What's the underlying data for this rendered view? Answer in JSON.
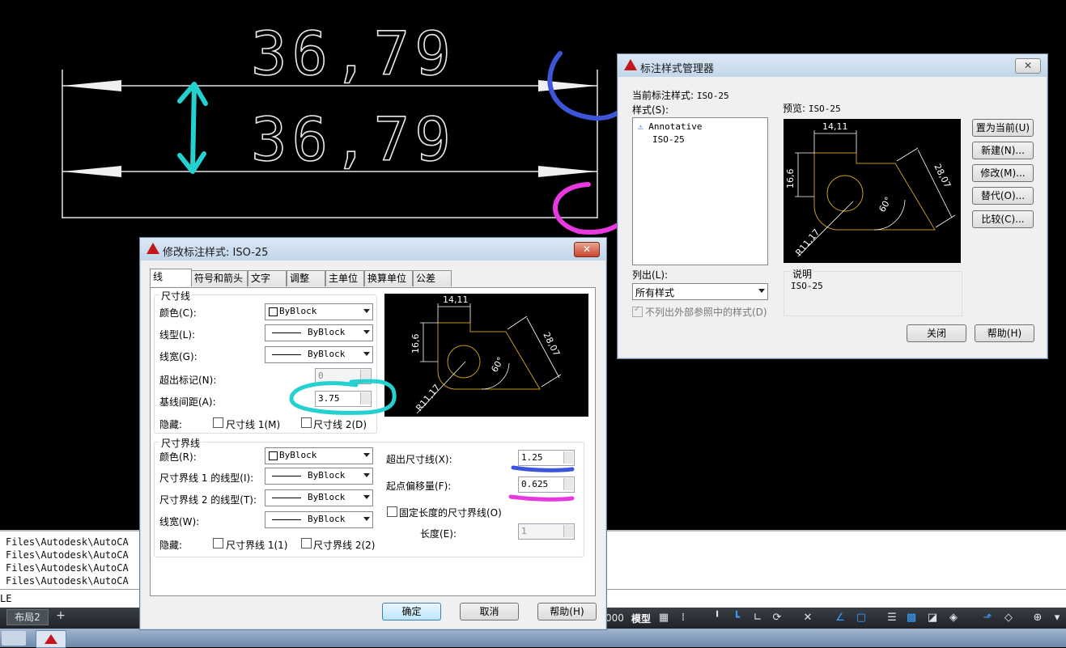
{
  "drawing": {
    "dim_text_top": "36,79",
    "dim_text_bottom": "36,79"
  },
  "command_line": {
    "lines": [
      "Files\\Autodesk\\AutoCA",
      "Files\\Autodesk\\AutoCA",
      "Files\\Autodesk\\AutoCA",
      "Files\\Autodesk\\AutoCA"
    ],
    "input_text": "LE"
  },
  "status_bar": {
    "layout_tab": "布局2",
    "add_tab": "+",
    "coord_tail": "000",
    "model_label": "模型"
  },
  "manager": {
    "title": "标注样式管理器",
    "close": "✕",
    "current_style_label": "当前标注样式:",
    "current_style_value": "ISO-25",
    "styles_label": "样式(S):",
    "styles": [
      "Annotative",
      "ISO-25"
    ],
    "preview_label": "预览:",
    "preview_value": "ISO-25",
    "buttons": {
      "set_current": "置为当前(U)",
      "new": "新建(N)...",
      "modify": "修改(M)...",
      "override": "替代(O)...",
      "compare": "比较(C)..."
    },
    "list_label": "列出(L):",
    "list_value": "所有样式",
    "exclude_xref": "不列出外部参照中的样式(D)",
    "description_label": "说明",
    "description_value": "ISO-25",
    "close_button": "关闭",
    "help_button": "帮助(H)"
  },
  "modify": {
    "title": "修改标注样式: ISO-25",
    "close": "✕",
    "tabs": [
      "线",
      "符号和箭头",
      "文字",
      "调整",
      "主单位",
      "换算单位",
      "公差"
    ],
    "dim_lines": {
      "group_label": "尺寸线",
      "color_label": "颜色(C):",
      "color_value": "ByBlock",
      "linetype_label": "线型(L):",
      "linetype_value": "ByBlock",
      "lineweight_label": "线宽(G):",
      "lineweight_value": "ByBlock",
      "extend_ticks_label": "超出标记(N):",
      "extend_ticks_value": "0",
      "baseline_label": "基线间距(A):",
      "baseline_value": "3.75",
      "suppress_label": "隐藏:",
      "suppress_1": "尺寸线 1(M)",
      "suppress_2": "尺寸线 2(D)"
    },
    "ext_lines": {
      "group_label": "尺寸界线",
      "color_label": "颜色(R):",
      "color_value": "ByBlock",
      "lt1_label": "尺寸界线 1 的线型(I):",
      "lt1_value": "ByBlock",
      "lt2_label": "尺寸界线 2 的线型(T):",
      "lt2_value": "ByBlock",
      "lineweight_label": "线宽(W):",
      "lineweight_value": "ByBlock",
      "suppress_label": "隐藏:",
      "suppress_1": "尺寸界线 1(1)",
      "suppress_2": "尺寸界线 2(2)",
      "extend_label": "超出尺寸线(X):",
      "extend_value": "1.25",
      "offset_label": "起点偏移量(F):",
      "offset_value": "0.625",
      "fixed_label": "固定长度的尺寸界线(O)",
      "length_label": "长度(E):",
      "length_value": "1"
    },
    "ok": "确定",
    "cancel": "取消",
    "help": "帮助(H)"
  },
  "preview_dims": {
    "top": "14,11",
    "left": "16,6",
    "right": "28,07",
    "angle": "60°",
    "radius": "R11,17"
  },
  "colors": {
    "annot_cyan": "#25d0d0",
    "annot_blue": "#3d55d8",
    "annot_magenta": "#e838e0",
    "preview_geom": "#c8961e"
  }
}
